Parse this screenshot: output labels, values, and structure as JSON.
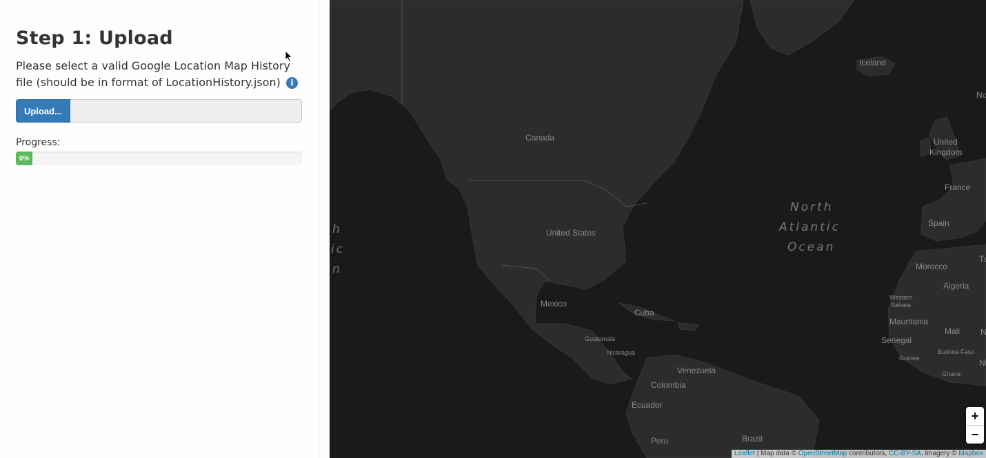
{
  "sidebar": {
    "title": "Step 1: Upload",
    "description": "Please select a valid Google Location Map History file (should be in format of LocationHistory.json)",
    "info_icon": "info-circle-icon",
    "upload_button": "Upload...",
    "upload_filename": "",
    "progress_label": "Progress:",
    "progress_text": "0%",
    "progress_value_percent": 0,
    "accent_color": "#337ab7",
    "progress_color": "#5cb85c"
  },
  "map": {
    "background_color": "#191a1a",
    "land_color": "#2c2c2c",
    "labels": {
      "iceland": "Iceland",
      "canada": "Canada",
      "united": "United",
      "kingdom": "Kingdom",
      "france": "France",
      "spain": "Spain",
      "north": "North",
      "atlantic": "Atlantic",
      "ocean": "Ocean",
      "united_states": "United States",
      "morocco": "Morocco",
      "algeria": "Algeria",
      "western": "Western",
      "sahara": "Sahara",
      "mauritania": "Mauritania",
      "mali": "Mali",
      "senegal": "Senegal",
      "guinea": "Guinea",
      "burkina_faso": "Burkina Faso",
      "ghana": "Ghana",
      "mexico": "Mexico",
      "cuba": "Cuba",
      "guatemala": "Guatemala",
      "nicaragua": "Nicaragua",
      "venezuela": "Venezuela",
      "colombia": "Colombia",
      "ecuador": "Ecuador",
      "peru": "Peru",
      "brazil": "Brazil",
      "pacific_1": "h",
      "pacific_2": "ic",
      "pacific_3": "n",
      "edge_no": "No",
      "edge_tu": "Tu",
      "edge_ni": "Ni",
      "edge_n": "N"
    },
    "zoom_in": "+",
    "zoom_out": "−",
    "attribution": {
      "leaflet": "Leaflet",
      "sep": " | Map data © ",
      "osm": "OpenStreetMap",
      "contributors": " contributors, ",
      "license": "CC-BY-SA",
      "imagery": ", Imagery © ",
      "mapbox": "Mapbox"
    }
  }
}
